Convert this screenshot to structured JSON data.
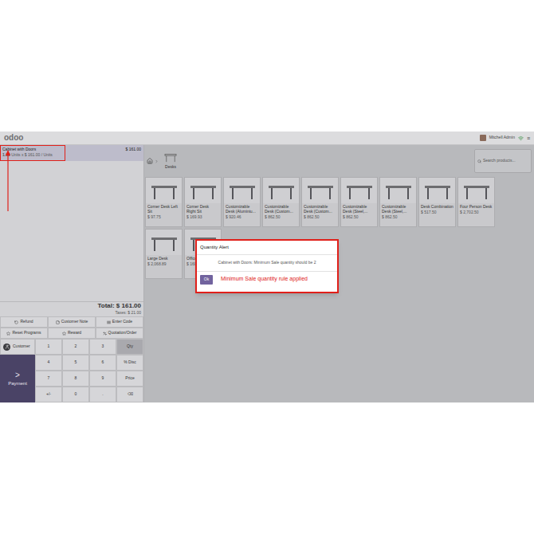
{
  "navbar": {
    "logo": "odoo",
    "user": "Mitchell Admin",
    "menu": "≡"
  },
  "order": {
    "lines": [
      {
        "name": "Cabinet with Doors",
        "price": "$ 161.00",
        "qty": "1.00",
        "detail": "Units x $ 161.00 / Units",
        "selected": true
      }
    ],
    "total": "Total: $ 161.00",
    "taxes": "Taxes: $ 21.00"
  },
  "actions": [
    {
      "label": "Refund"
    },
    {
      "label": "Customer Note"
    },
    {
      "label": "Enter Code"
    },
    {
      "label": "Reset Programs"
    },
    {
      "label": "Reward"
    },
    {
      "label": "Quotation/Order"
    }
  ],
  "numpad": {
    "customer": "Customer",
    "payment_arrow": ">",
    "payment": "Payment",
    "keys": [
      {
        "label": "1",
        "selected": false
      },
      {
        "label": "2",
        "selected": false
      },
      {
        "label": "3",
        "selected": false
      },
      {
        "label": "Qty",
        "selected": true
      },
      {
        "label": "4",
        "selected": false
      },
      {
        "label": "5",
        "selected": false
      },
      {
        "label": "6",
        "selected": false
      },
      {
        "label": "% Disc",
        "selected": false
      },
      {
        "label": "7",
        "selected": false
      },
      {
        "label": "8",
        "selected": false
      },
      {
        "label": "9",
        "selected": false
      },
      {
        "label": "Price",
        "selected": false
      },
      {
        "label": "+/-",
        "selected": false
      },
      {
        "label": "0",
        "selected": false
      },
      {
        "label": ".",
        "selected": false
      },
      {
        "label": "⌫",
        "selected": false
      }
    ]
  },
  "breadcrumb": {
    "category": "Desks"
  },
  "search": {
    "placeholder": "Search products..."
  },
  "products": [
    {
      "name": "Corner Desk Left Sit",
      "price": "$ 97.75"
    },
    {
      "name": "Corner Desk Right Sit",
      "price": "$ 169.93"
    },
    {
      "name": "Customizable Desk (Aluminiu...",
      "price": "$ 920.46"
    },
    {
      "name": "Customizable Desk (Custom...",
      "price": "$ 862.50"
    },
    {
      "name": "Customizable Desk (Custom...",
      "price": "$ 862.50"
    },
    {
      "name": "Customizable Desk (Steel,...",
      "price": "$ 862.50"
    },
    {
      "name": "Customizable Desk (Steel,...",
      "price": "$ 862.50"
    },
    {
      "name": "Desk Combination",
      "price": "$ 517.50"
    },
    {
      "name": "Four Person Desk",
      "price": "$ 2,702.50"
    },
    {
      "name": "Large Desk",
      "price": "$ 2,068.89"
    },
    {
      "name": "Office combo",
      "price": "$ 160.00"
    }
  ],
  "dialog": {
    "title": "Quantity Alert",
    "message": "Cabinet with Doors: Minimum Sale quantity should be 2",
    "button": "Ok"
  },
  "annotations": {
    "note": "Minimum Sale quantity rule applied"
  }
}
